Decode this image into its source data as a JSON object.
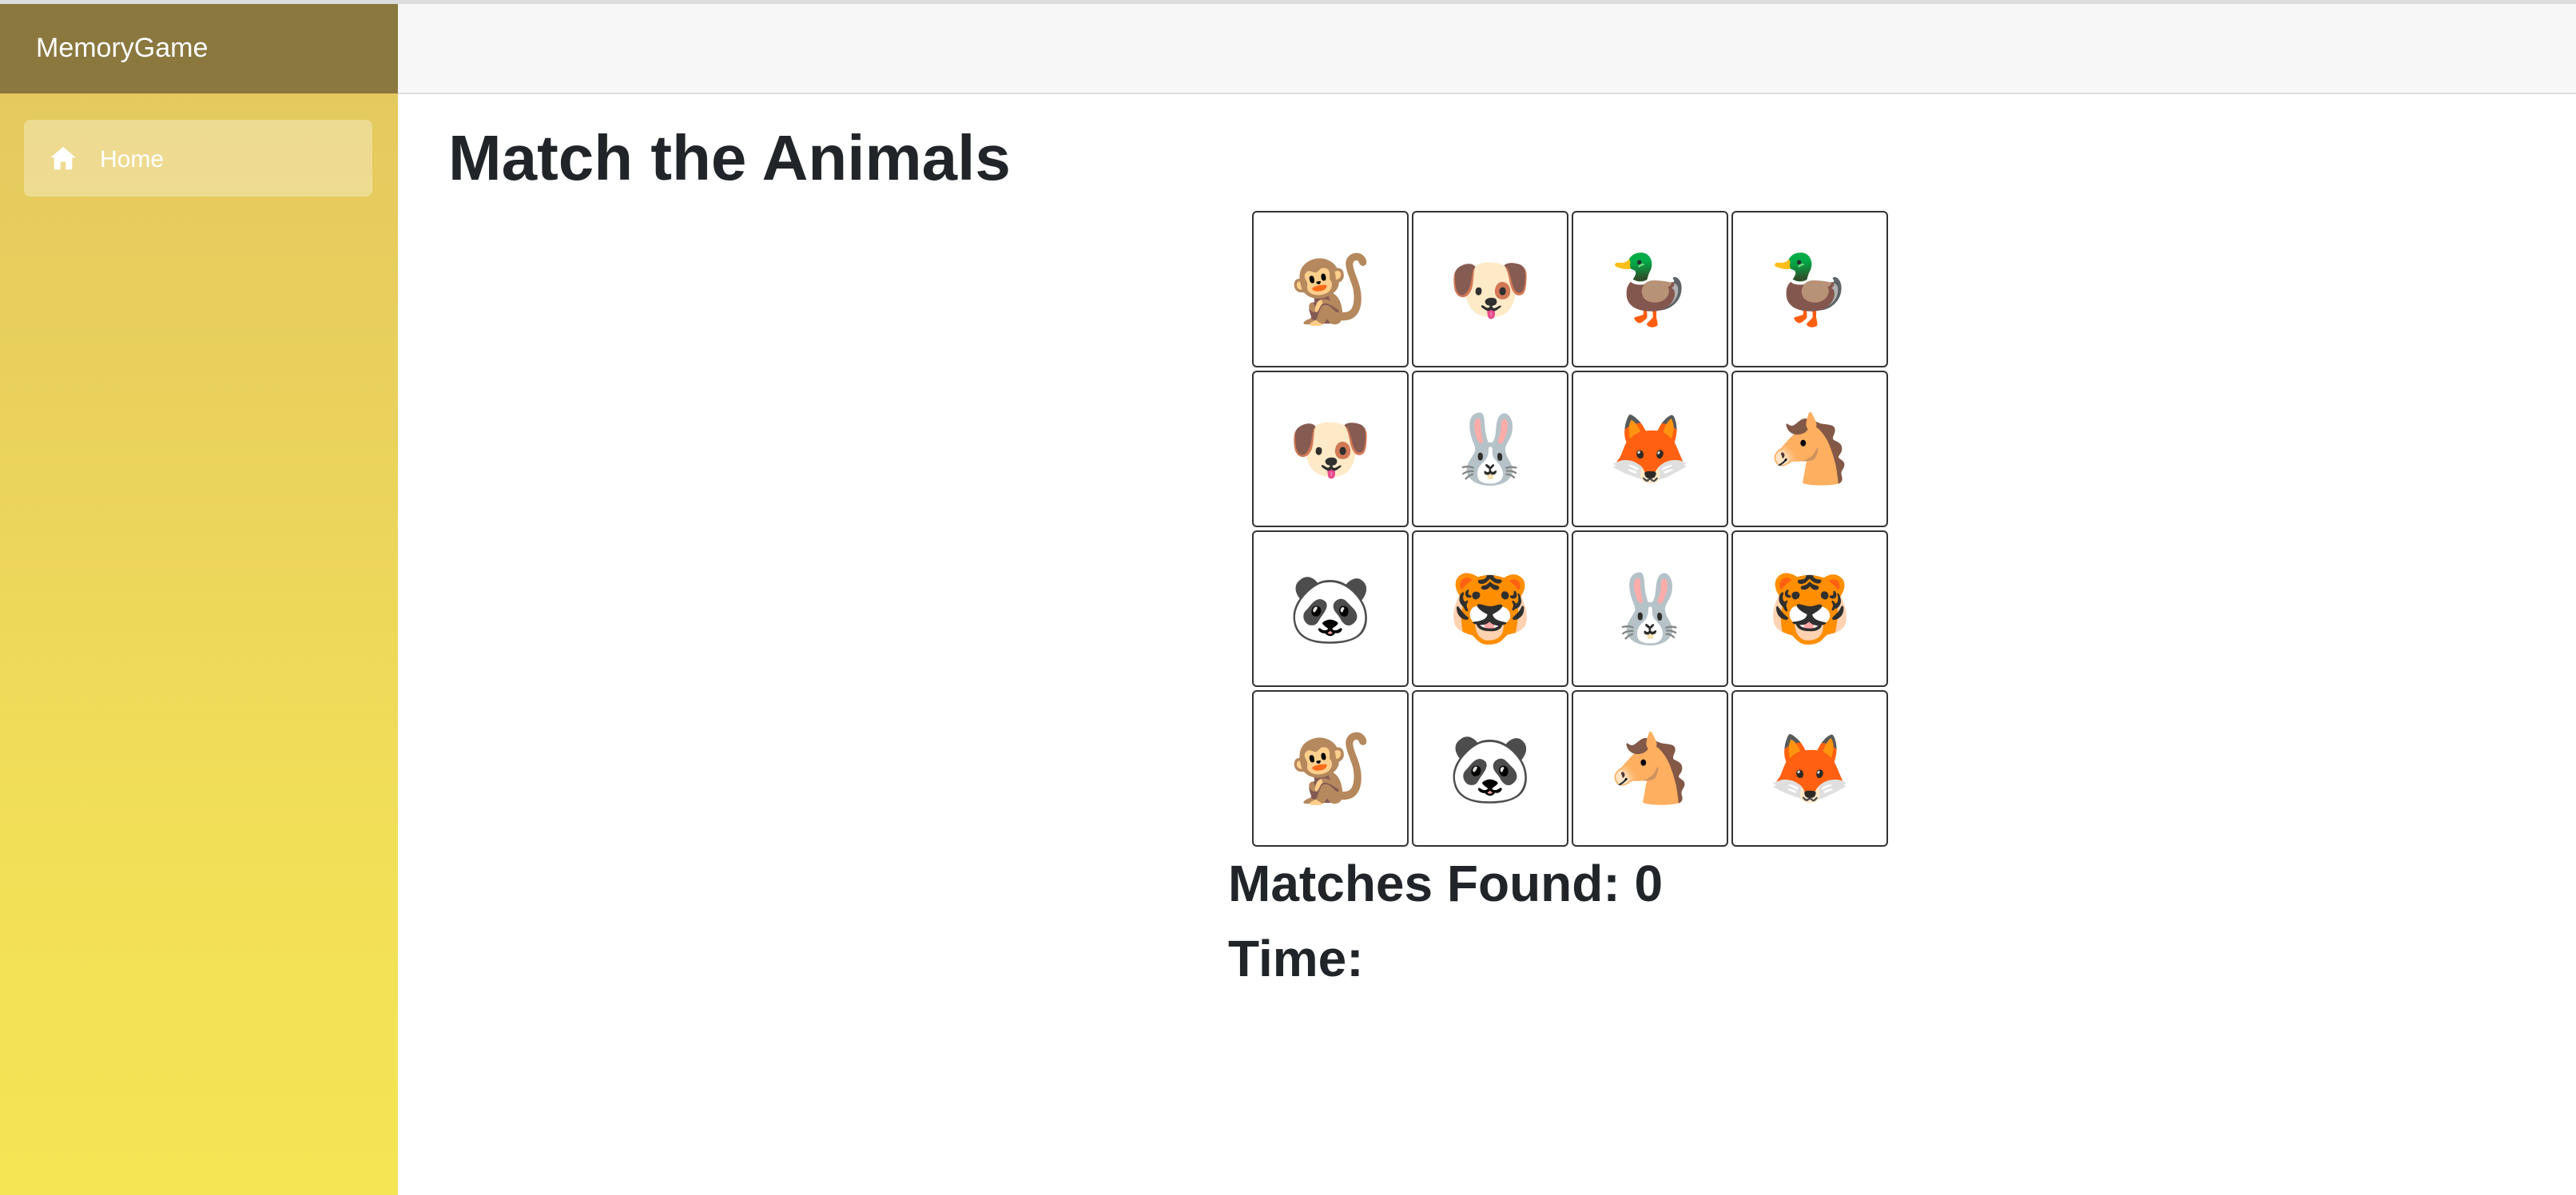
{
  "app": {
    "title": "MemoryGame"
  },
  "sidebar": {
    "items": [
      {
        "label": "Home",
        "icon": "home-icon",
        "active": true
      }
    ]
  },
  "main": {
    "title": "Match the Animals",
    "grid": {
      "rows": 4,
      "cols": 4,
      "cards": [
        {
          "animal": "monkey",
          "emoji": "🐒"
        },
        {
          "animal": "dog",
          "emoji": "🐶"
        },
        {
          "animal": "duck",
          "emoji": "🦆"
        },
        {
          "animal": "duck",
          "emoji": "🦆"
        },
        {
          "animal": "dog",
          "emoji": "🐶"
        },
        {
          "animal": "rabbit",
          "emoji": "🐰"
        },
        {
          "animal": "fox",
          "emoji": "🦊"
        },
        {
          "animal": "horse",
          "emoji": "🐴"
        },
        {
          "animal": "panda",
          "emoji": "🐼"
        },
        {
          "animal": "tiger",
          "emoji": "🐯"
        },
        {
          "animal": "rabbit",
          "emoji": "🐰"
        },
        {
          "animal": "tiger",
          "emoji": "🐯"
        },
        {
          "animal": "monkey",
          "emoji": "🐒"
        },
        {
          "animal": "panda",
          "emoji": "🐼"
        },
        {
          "animal": "horse",
          "emoji": "🐴"
        },
        {
          "animal": "fox",
          "emoji": "🦊"
        }
      ]
    },
    "matches_label": "Matches Found: 0",
    "time_label": "Time:"
  },
  "colors": {
    "sidebar_header": "#8a783f",
    "sidebar_gradient_top": "#e3c75e",
    "sidebar_gradient_bottom": "#f5e454",
    "text": "#212529"
  }
}
